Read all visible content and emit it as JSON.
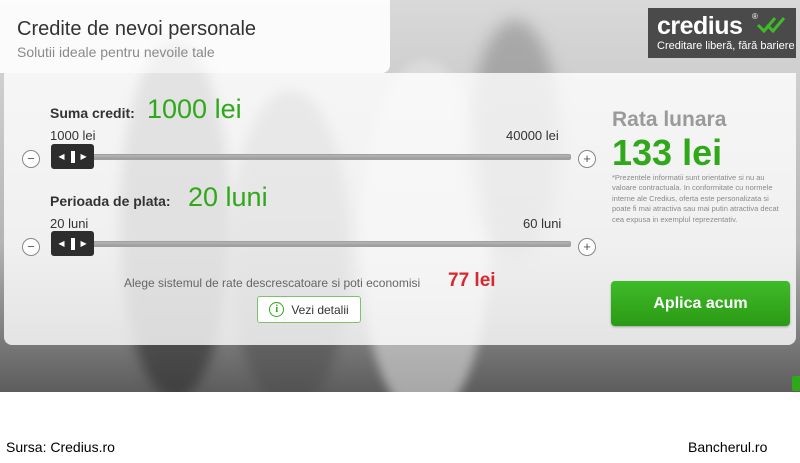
{
  "header": {
    "title": "Credite de nevoi personale",
    "subtitle": "Solutii ideale pentru nevoile tale"
  },
  "logo": {
    "name": "credius",
    "tagline": "Creditare liberă, fără bariere"
  },
  "amount": {
    "label": "Suma credit:",
    "value": "1000 lei",
    "min_label": "1000 lei",
    "max_label": "40000 lei",
    "minus": "−",
    "plus": "+"
  },
  "period": {
    "label": "Perioada de plata:",
    "value": "20 luni",
    "min_label": "20 luni",
    "max_label": "60 luni",
    "minus": "−",
    "plus": "+"
  },
  "promo": {
    "text": "Alege sistemul de rate descrescatoare si poti economisi",
    "amount": "77 lei"
  },
  "details_button": {
    "label": "Vezi detalii"
  },
  "rate": {
    "label": "Rata lunara",
    "value": "133 lei",
    "disclaimer": "*Prezentele informatii sunt orientative si nu au valoare contractuala. In conformitate cu normele interne ale Credius, oferta este personalizata si poate fi mai atractiva sau mai putin atractiva decat cea expusa in exemplul reprezentativ."
  },
  "apply_button": {
    "label": "Aplica acum"
  },
  "footer": {
    "source": "Sursa: Credius.ro",
    "site": "Bancherul.ro"
  },
  "colors": {
    "accent": "#2fa81a",
    "highlight": "#d7282f",
    "logo_bg": "#4a4a4a"
  }
}
